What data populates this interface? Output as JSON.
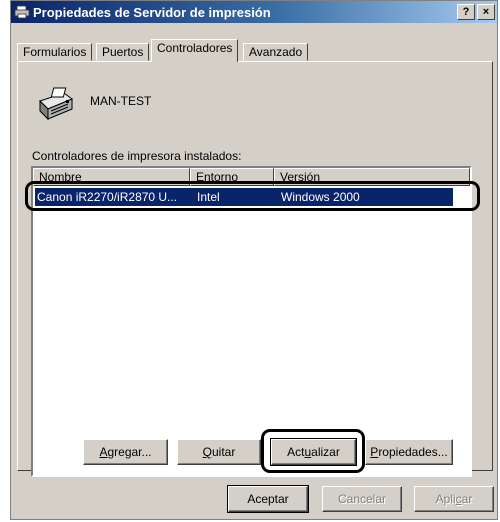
{
  "title_bar": {
    "title": "Propiedades de Servidor de impresión",
    "help_button": "?",
    "close_button": "×"
  },
  "tabs": [
    {
      "label": "Formularios",
      "active": false
    },
    {
      "label": "Puertos",
      "active": false
    },
    {
      "label": "Controladores",
      "active": true
    },
    {
      "label": "Avanzado",
      "active": false
    }
  ],
  "server": {
    "name": "MAN-TEST",
    "icon": "printer-server-icon"
  },
  "drivers": {
    "label": "Controladores de impresora instalados:",
    "columns": [
      "Nombre",
      "Entorno",
      "Versión"
    ],
    "rows": [
      {
        "name": "Canon iR2270/iR2870 U...",
        "environment": "Intel",
        "version": "Windows 2000",
        "selected": true
      }
    ]
  },
  "driver_buttons": {
    "add": {
      "prefix": "",
      "accel": "A",
      "suffix": "gregar..."
    },
    "remove": {
      "prefix": "",
      "accel": "Q",
      "suffix": "uitar"
    },
    "update": {
      "prefix": "Act",
      "accel": "u",
      "suffix": "alizar"
    },
    "properties": {
      "prefix": "",
      "accel": "P",
      "suffix": "ropiedades..."
    }
  },
  "dialog_buttons": {
    "ok": "Aceptar",
    "cancel": "Cancelar",
    "apply": {
      "prefix": "Apli",
      "accel": "c",
      "suffix": "ar"
    }
  },
  "colors": {
    "title_gradient_start": "#0a246a",
    "selection": "#0a246a",
    "face": "#d4d0c8"
  }
}
